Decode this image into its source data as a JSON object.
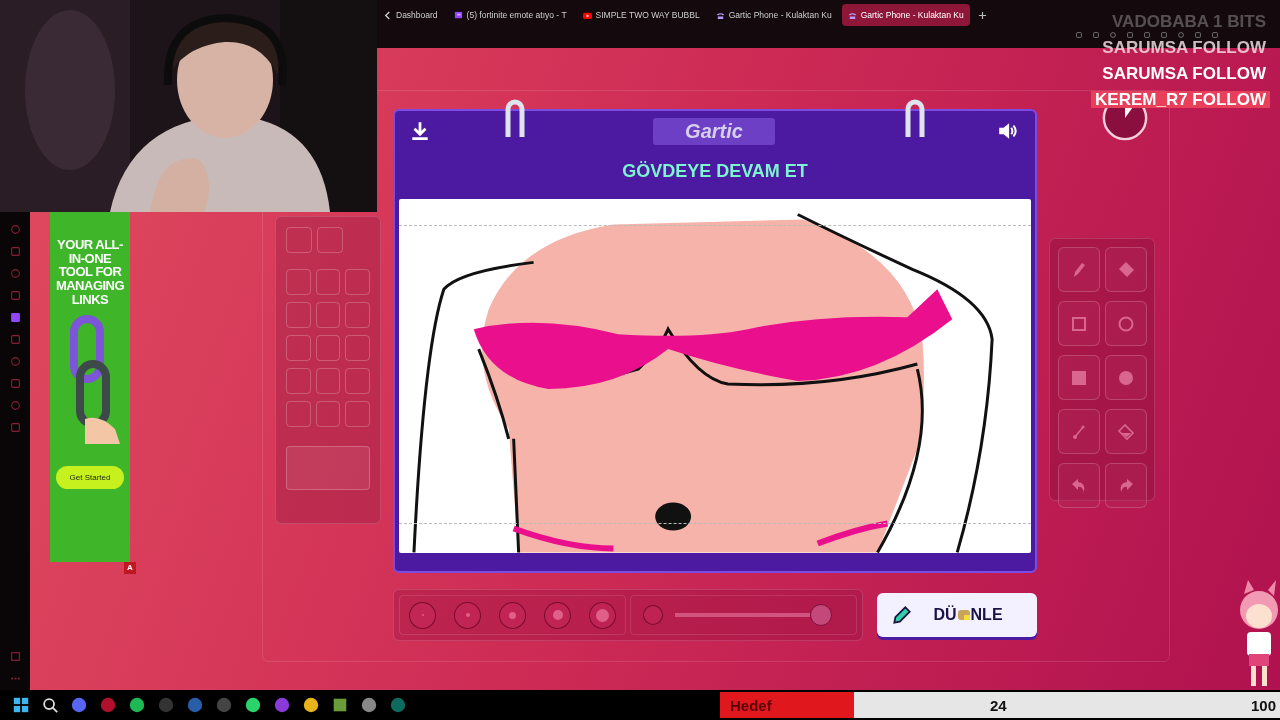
{
  "browser": {
    "tabs": [
      {
        "title": "Dashboard",
        "kind": "back",
        "selected": false
      },
      {
        "title": "(5) fortinite emote atıyo - T",
        "kind": "twitch",
        "selected": false
      },
      {
        "title": "SIMPLE TWO WAY BUBBL",
        "kind": "video",
        "selected": false
      },
      {
        "title": "Gartic Phone - Kulaktan Ku",
        "kind": "phone",
        "selected": false
      },
      {
        "title": "Gartic Phone - Kulaktan Ku",
        "kind": "phone",
        "selected": true
      }
    ]
  },
  "ad": {
    "headline": "YOUR ALL-IN-ONE TOOL FOR MANAGING LINKS",
    "cta": "Get Started",
    "badge": "A"
  },
  "game": {
    "logo": "Gartic",
    "prompt": "GÖVDEYE DEVAM ET",
    "tools": [
      {
        "kind": "pencil"
      },
      {
        "kind": "eraser"
      },
      {
        "kind": "rect"
      },
      {
        "kind": "circle"
      },
      {
        "kind": "filled-rect"
      },
      {
        "kind": "filled-circle"
      },
      {
        "kind": "line"
      },
      {
        "kind": "bucket"
      },
      {
        "kind": "undo"
      },
      {
        "kind": "redo"
      }
    ],
    "brush_sizes": [
      {
        "kind": "size"
      },
      {
        "kind": "size"
      },
      {
        "kind": "size"
      },
      {
        "kind": "size"
      },
      {
        "kind": "size"
      }
    ],
    "opacity_slider": {
      "level": 1
    },
    "timer": {
      "level": 0.1
    },
    "edit_button": {
      "label_start": "DÜ",
      "label_end": "NLE"
    }
  },
  "stream_overlay": {
    "alerts": [
      {
        "text": "VADOBABA 1 BITS",
        "kind": "fading"
      },
      {
        "text": "SARUMSA FOLLOW",
        "kind": "dim"
      },
      {
        "text": "SARUMSA FOLLOW",
        "kind": "plain"
      },
      {
        "text": "KEREM_R7 FOLLOW",
        "kind": "highlight"
      }
    ],
    "goal": {
      "label": "Hedef",
      "current": "24",
      "target": "100",
      "level": 0.24
    }
  }
}
